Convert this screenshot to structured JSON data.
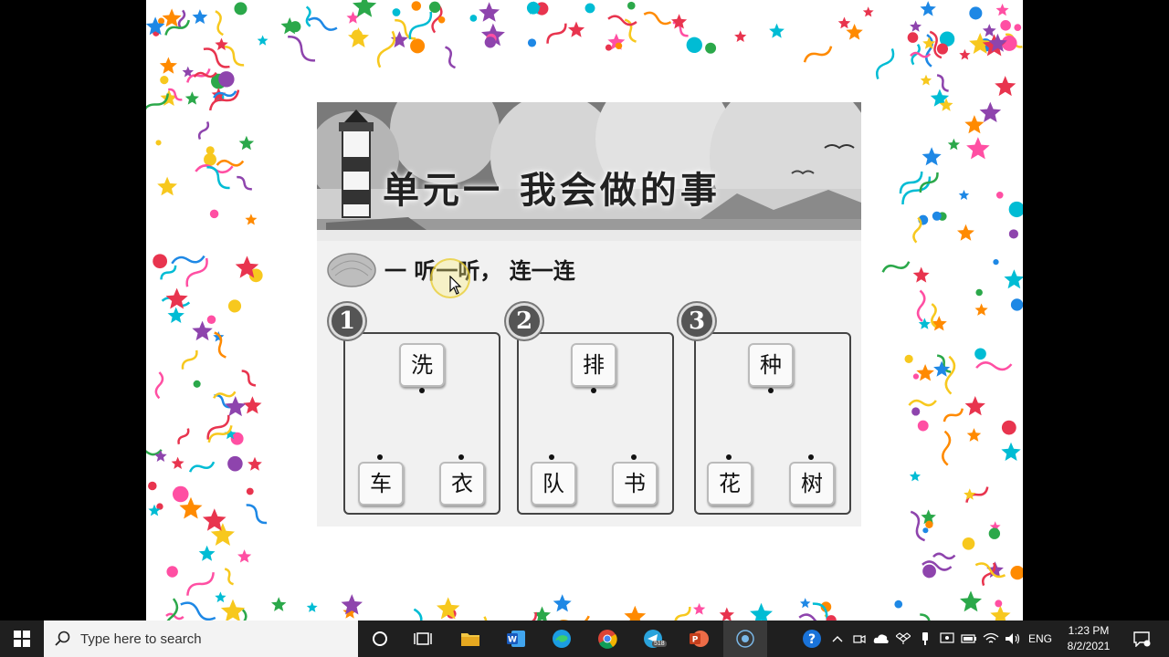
{
  "slide": {
    "banner_title": "单元一 我会做的事",
    "heading": "一 听一听， 连一连",
    "groups": [
      {
        "number": "1",
        "top": "洗",
        "left": "车",
        "right": "衣"
      },
      {
        "number": "2",
        "top": "排",
        "left": "队",
        "right": "书"
      },
      {
        "number": "3",
        "top": "种",
        "left": "花",
        "right": "树"
      }
    ]
  },
  "taskbar": {
    "search_placeholder": "Type here to search",
    "apps": [
      "cortana",
      "task-view",
      "file-explorer",
      "word",
      "edge",
      "chrome",
      "telegram",
      "powerpoint",
      "screen-recorder"
    ],
    "telegram_badge": "518",
    "language": "ENG",
    "time": "1:23 PM",
    "date": "8/2/2021"
  },
  "colors": {
    "taskbar_bg": "#1f1f1f",
    "search_bg": "#f3f3f3",
    "slide_bg": "#ffffff"
  }
}
